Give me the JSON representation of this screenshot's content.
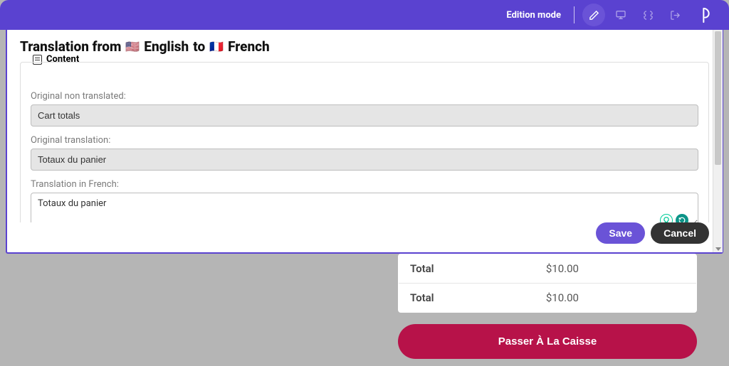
{
  "topbar": {
    "mode_label": "Edition mode"
  },
  "modal": {
    "title_prefix": "Translation from",
    "from_lang": "English",
    "to_word": "to",
    "to_lang": "French",
    "flag_from": "🇺🇸",
    "flag_to": "🇫🇷",
    "fieldset_label": "Content",
    "labels": {
      "original_non_translated": "Original non translated:",
      "original_translation": "Original translation:",
      "translation_in_french": "Translation in French:"
    },
    "values": {
      "original_non_translated": "Cart totals",
      "original_translation": "Totaux du panier",
      "translation_in_french": "Totaux du panier"
    },
    "buttons": {
      "save": "Save",
      "cancel": "Cancel"
    }
  },
  "background": {
    "rows": [
      {
        "label": "Total",
        "value": "$10.00"
      },
      {
        "label": "Total",
        "value": "$10.00"
      }
    ],
    "checkout_label": "Passer À La Caisse"
  }
}
